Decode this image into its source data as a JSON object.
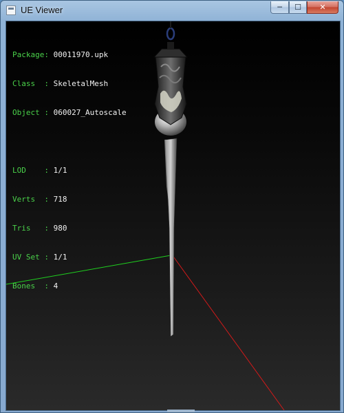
{
  "window": {
    "title": "UE Viewer",
    "controls": {
      "minimize": "─",
      "maximize": "☐",
      "close": "✕"
    }
  },
  "info": {
    "package_label": "Package:",
    "package_value": "00011970.upk",
    "class_label": "Class  :",
    "class_value": "SkeletalMesh",
    "object_label": "Object :",
    "object_value": "060027_Autoscale",
    "lod_label": "LOD    :",
    "lod_value": "1/1",
    "verts_label": "Verts  :",
    "verts_value": "718",
    "tris_label": "Tris   :",
    "tris_value": "980",
    "uvset_label": "UV Set :",
    "uvset_value": "1/1",
    "bones_label": "Bones  :",
    "bones_value": "4"
  },
  "scene": {
    "background_top": "#000000",
    "background_bottom": "#2a2a2a",
    "axis_x_color": "#d11a1a",
    "axis_y_color": "#1fd11f",
    "mesh_color": "#a9a9a9"
  }
}
